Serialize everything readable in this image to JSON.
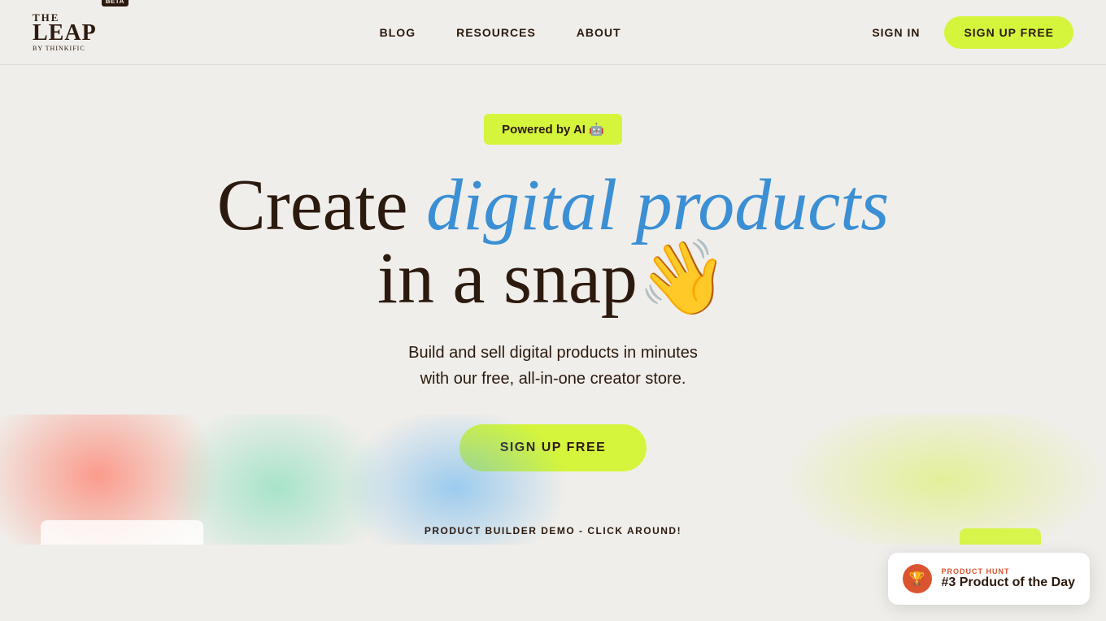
{
  "nav": {
    "logo_the": "THE",
    "logo_leap": "LEAP",
    "logo_sub": "BY THINKIFIC",
    "logo_beta": "BETA",
    "links": [
      {
        "label": "BLOG",
        "id": "blog"
      },
      {
        "label": "RESOURCES",
        "id": "resources"
      },
      {
        "label": "ABOUT",
        "id": "about"
      }
    ],
    "sign_in": "SIGN IN",
    "sign_up": "SIGN UP FREE"
  },
  "hero": {
    "powered_badge": "Powered by AI 🤖",
    "title_part1": "Create ",
    "title_highlight": "digital products",
    "title_part2": "in a snap",
    "title_emoji": "👋",
    "subtitle_line1": "Build and sell digital products in minutes",
    "subtitle_line2": "with our free, all-in-one creator store.",
    "cta_button": "SIGN UP FREE"
  },
  "bottom": {
    "demo_text": "PRODUCT BUILDER DEMO - CLICK AROUND!"
  },
  "product_hunt": {
    "label": "PRODUCT HUNT",
    "title": "#3 Product of the Day",
    "icon": "🏆"
  }
}
